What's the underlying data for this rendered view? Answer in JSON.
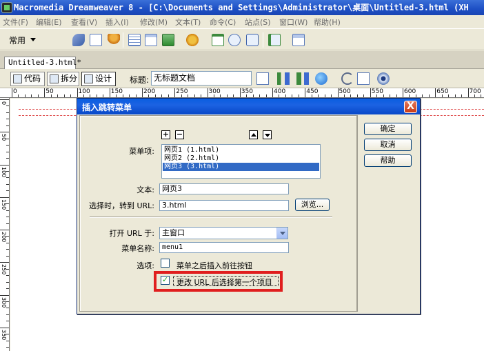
{
  "window": {
    "title": "Macromedia Dreamweaver 8 - [C:\\Documents and Settings\\Administrator\\桌面\\Untitled-3.html (XH"
  },
  "menubar": {
    "items": [
      "文件(F)",
      "编辑(E)",
      "查看(V)",
      "插入(I)",
      "修改(M)",
      "文本(T)",
      "命令(C)",
      "站点(S)",
      "窗口(W)",
      "帮助(H)"
    ]
  },
  "toolbar": {
    "category": "常用"
  },
  "document": {
    "tab_label": "Untitled-3.html*",
    "code_view": "代码",
    "split_view": "拆分",
    "design_view": "设计",
    "title_label": "标题:",
    "title_value": "无标题文档"
  },
  "ruler": {
    "h_labels": [
      "0",
      "50",
      "100",
      "150",
      "200",
      "250",
      "300",
      "350",
      "400",
      "450",
      "500",
      "550",
      "600",
      "650",
      "700"
    ],
    "v_labels": [
      "0",
      "50",
      "100",
      "150",
      "200",
      "250",
      "300",
      "350"
    ]
  },
  "dialog": {
    "title": "插入跳转菜单",
    "add_symbol": "+",
    "remove_symbol": "−",
    "menu_items_label": "菜单项:",
    "menu_items": [
      {
        "text": "网页1 (1.html)",
        "selected": false
      },
      {
        "text": "网页2 (2.html)",
        "selected": false
      },
      {
        "text": "网页3 (3.html)",
        "selected": true
      }
    ],
    "text_label": "文本:",
    "text_value": "网页3",
    "url_label": "选择时，转到 URL:",
    "url_value": "3.html",
    "browse_button": "浏览...",
    "open_in_label": "打开 URL 于:",
    "open_in_value": "主窗口",
    "menu_name_label": "菜单名称:",
    "menu_name_value": "menu1",
    "options_label": "选项:",
    "option_go_button": {
      "label": "菜单之后插入前往按钮",
      "checked": false
    },
    "option_select_first": {
      "label": "更改 URL 后选择第一个项目",
      "checked": true
    },
    "ok_button": "确定",
    "cancel_button": "取消",
    "help_button": "帮助",
    "close_symbol": "X",
    "check_symbol": "✓"
  },
  "colors": {
    "highlight": "#e01e1e",
    "selection": "#316ac5",
    "titlebar": "#0a5ee0"
  }
}
